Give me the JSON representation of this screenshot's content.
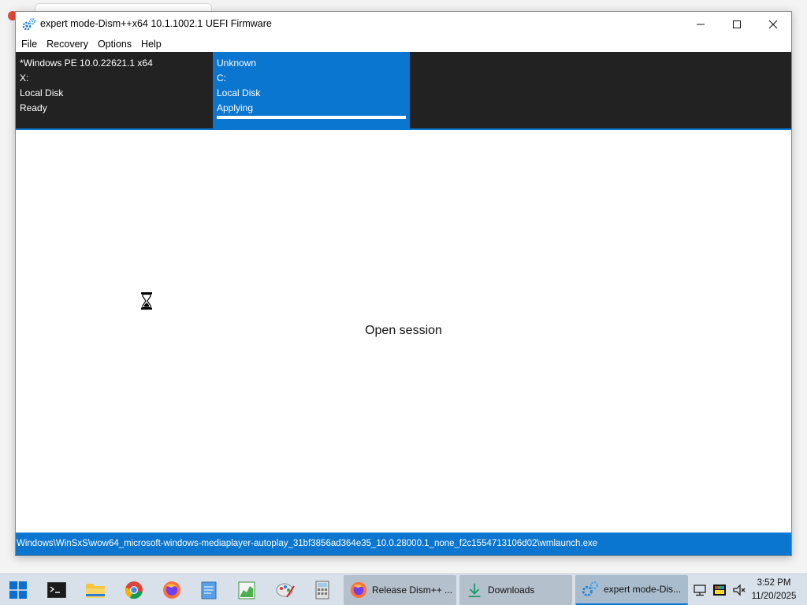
{
  "window": {
    "title": "expert mode-Dism++x64 10.1.1002.1 UEFI Firmware"
  },
  "menu": {
    "items": [
      "File",
      "Recovery",
      "Options",
      "Help"
    ]
  },
  "info_panel": {
    "left": [
      "*Windows PE 10.0.22621.1 x64",
      "X:",
      "Local Disk",
      "Ready"
    ],
    "selected": [
      "Unknown",
      "C:",
      "Local Disk",
      "Applying"
    ],
    "progress": 1.0
  },
  "content": {
    "session_text": "Open session"
  },
  "statusbar": {
    "path": "Windows\\WinSxS\\wow64_microsoft-windows-mediaplayer-autoplay_31bf3856ad364e35_10.0.28000.1_none_f2c1554713106d02\\wmlaunch.exe"
  },
  "taskbar": {
    "tasks": [
      {
        "label": "Release Dism++ ...",
        "icon": "firefox-icon"
      },
      {
        "label": "Downloads",
        "icon": "download-icon"
      },
      {
        "label": "expert mode-Dis...",
        "icon": "dism-icon"
      }
    ],
    "clock": {
      "time": "3:52 PM",
      "date": "11/20/2025"
    }
  },
  "colors": {
    "accent": "#0a76d0",
    "panel_bg": "#222222"
  }
}
